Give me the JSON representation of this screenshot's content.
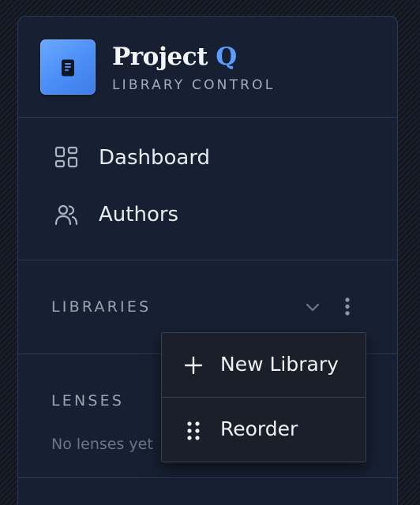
{
  "brand": {
    "title_main": "Project",
    "title_accent": "Q",
    "subtitle": "LIBRARY CONTROL",
    "logo_icon": "book-icon",
    "accent_color": "#5b9cff"
  },
  "nav": {
    "items": [
      {
        "label": "Dashboard",
        "icon": "dashboard-grid-icon"
      },
      {
        "label": "Authors",
        "icon": "users-icon"
      }
    ]
  },
  "libraries": {
    "label": "LIBRARIES",
    "collapse_icon": "chevron-down-icon",
    "more_icon": "kebab-menu-icon"
  },
  "lenses": {
    "label": "LENSES",
    "empty_text": "No lenses yet"
  },
  "context_menu": {
    "items": [
      {
        "label": "New Library",
        "icon": "plus-icon"
      },
      {
        "label": "Reorder",
        "icon": "drag-handle-icon"
      }
    ]
  }
}
